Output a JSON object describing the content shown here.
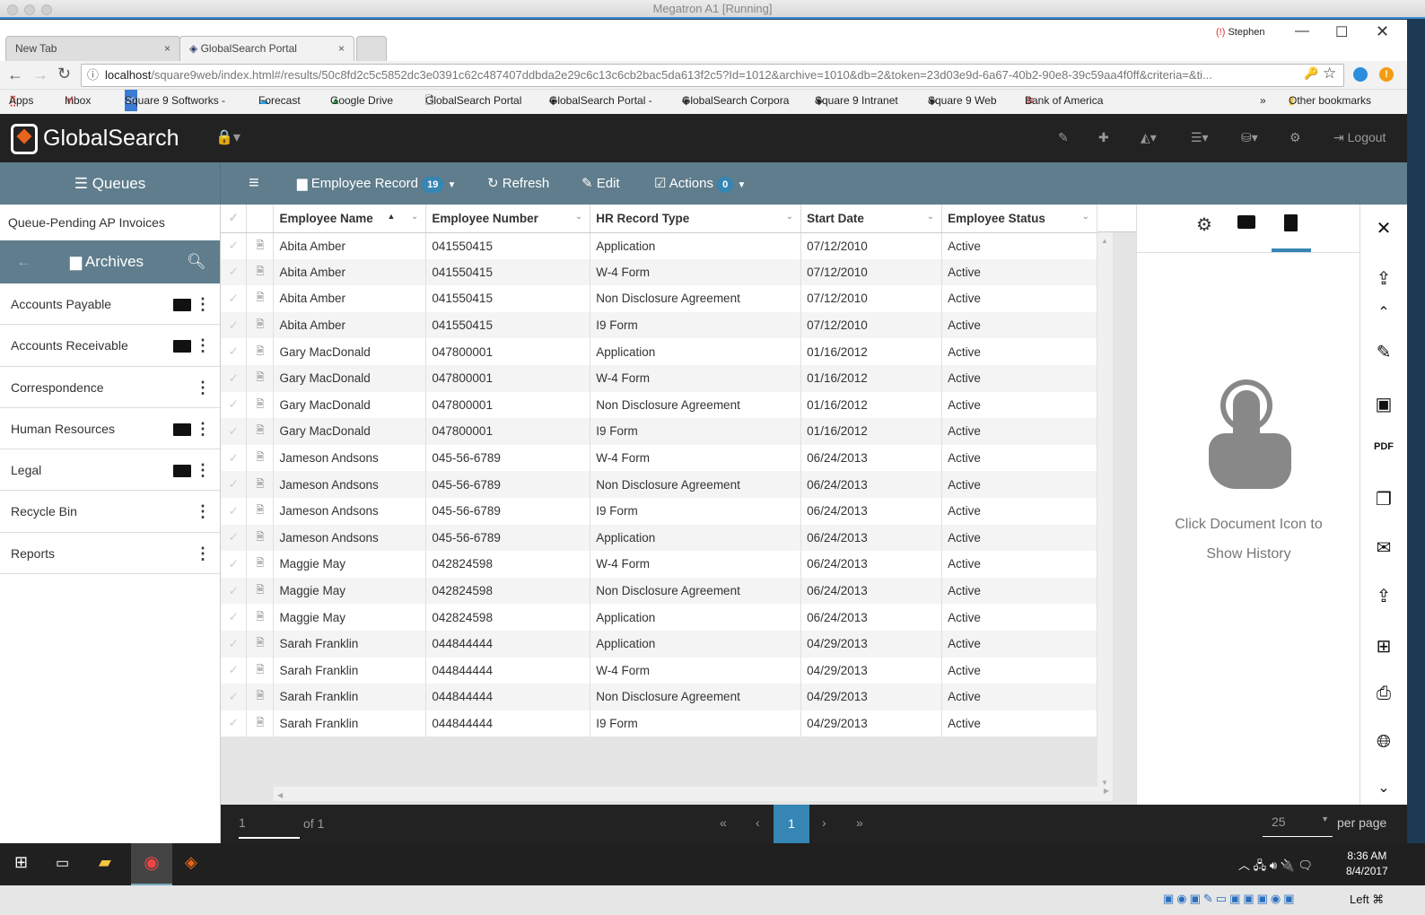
{
  "window": {
    "title": "Megatron A1 [Running]"
  },
  "browser": {
    "tabs": [
      {
        "label": "New Tab"
      },
      {
        "label": "GlobalSearch Portal"
      }
    ],
    "url_host": "localhost",
    "url_rest": "/square9web/index.html#/results/50c8fd2c5c5852dc3e0391c62c487407ddbda2e29c6c13c6cb2bac5da613f2c5?Id=1012&archive=1010&db=2&token=23d03e9d-6a67-40b2-90e8-39c59aa4f0ff&criteria=&ti...",
    "profile": "Stephen",
    "bookmarks": [
      "Apps",
      "Inbox",
      "Square 9 Softworks -",
      "Forecast",
      "Google Drive",
      "GlobalSearch Portal",
      "GlobalSearch Portal -",
      "GlobalSearch Corpora",
      "Square 9 Intranet",
      "Square 9 Web",
      "Bank of America"
    ],
    "other_bookmarks": "Other bookmarks"
  },
  "app": {
    "logo": "GlobalSearch",
    "logout": "Logout"
  },
  "toolbar": {
    "queues": "Queues",
    "record": "Employee Record",
    "record_count": "19",
    "refresh": "Refresh",
    "edit": "Edit",
    "actions": "Actions",
    "actions_count": "0"
  },
  "sidebar": {
    "queue": "Queue-Pending AP Invoices",
    "archives": "Archives",
    "items": [
      {
        "label": "Accounts Payable",
        "folder": true
      },
      {
        "label": "Accounts Receivable",
        "folder": true
      },
      {
        "label": "Correspondence",
        "folder": false
      },
      {
        "label": "Human Resources",
        "folder": true
      },
      {
        "label": "Legal",
        "folder": true
      },
      {
        "label": "Recycle Bin",
        "folder": false
      },
      {
        "label": "Reports",
        "folder": false
      }
    ]
  },
  "grid": {
    "columns": [
      "Employee Name",
      "Employee Number",
      "HR Record Type",
      "Start Date",
      "Employee Status"
    ],
    "rows": [
      [
        "Abita Amber",
        "041550415",
        "Application",
        "07/12/2010",
        "Active"
      ],
      [
        "Abita Amber",
        "041550415",
        "W-4 Form",
        "07/12/2010",
        "Active"
      ],
      [
        "Abita Amber",
        "041550415",
        "Non Disclosure Agreement",
        "07/12/2010",
        "Active"
      ],
      [
        "Abita Amber",
        "041550415",
        "I9 Form",
        "07/12/2010",
        "Active"
      ],
      [
        "Gary MacDonald",
        "047800001",
        "Application",
        "01/16/2012",
        "Active"
      ],
      [
        "Gary MacDonald",
        "047800001",
        "W-4 Form",
        "01/16/2012",
        "Active"
      ],
      [
        "Gary MacDonald",
        "047800001",
        "Non Disclosure Agreement",
        "01/16/2012",
        "Active"
      ],
      [
        "Gary MacDonald",
        "047800001",
        "I9 Form",
        "01/16/2012",
        "Active"
      ],
      [
        "Jameson Andsons",
        "045-56-6789",
        "W-4 Form",
        "06/24/2013",
        "Active"
      ],
      [
        "Jameson Andsons",
        "045-56-6789",
        "Non Disclosure Agreement",
        "06/24/2013",
        "Active"
      ],
      [
        "Jameson Andsons",
        "045-56-6789",
        "I9 Form",
        "06/24/2013",
        "Active"
      ],
      [
        "Jameson Andsons",
        "045-56-6789",
        "Application",
        "06/24/2013",
        "Active"
      ],
      [
        "Maggie May",
        "042824598",
        "W-4 Form",
        "06/24/2013",
        "Active"
      ],
      [
        "Maggie May",
        "042824598",
        "Non Disclosure Agreement",
        "06/24/2013",
        "Active"
      ],
      [
        "Maggie May",
        "042824598",
        "Application",
        "06/24/2013",
        "Active"
      ],
      [
        "Sarah Franklin",
        "044844444",
        "Application",
        "04/29/2013",
        "Active"
      ],
      [
        "Sarah Franklin",
        "044844444",
        "W-4 Form",
        "04/29/2013",
        "Active"
      ],
      [
        "Sarah Franklin",
        "044844444",
        "Non Disclosure Agreement",
        "04/29/2013",
        "Active"
      ],
      [
        "Sarah Franklin",
        "044844444",
        "I9 Form",
        "04/29/2013",
        "Active"
      ]
    ]
  },
  "panel": {
    "message_line1": "Click Document Icon to",
    "message_line2": "Show History"
  },
  "pager": {
    "page": "1",
    "of": "of 1",
    "current": "1",
    "per_page_value": "25",
    "per_page": "per page"
  },
  "taskbar": {
    "time": "8:36 AM",
    "date": "8/4/2017"
  },
  "vbox": {
    "hostkey": "Left ⌘"
  }
}
